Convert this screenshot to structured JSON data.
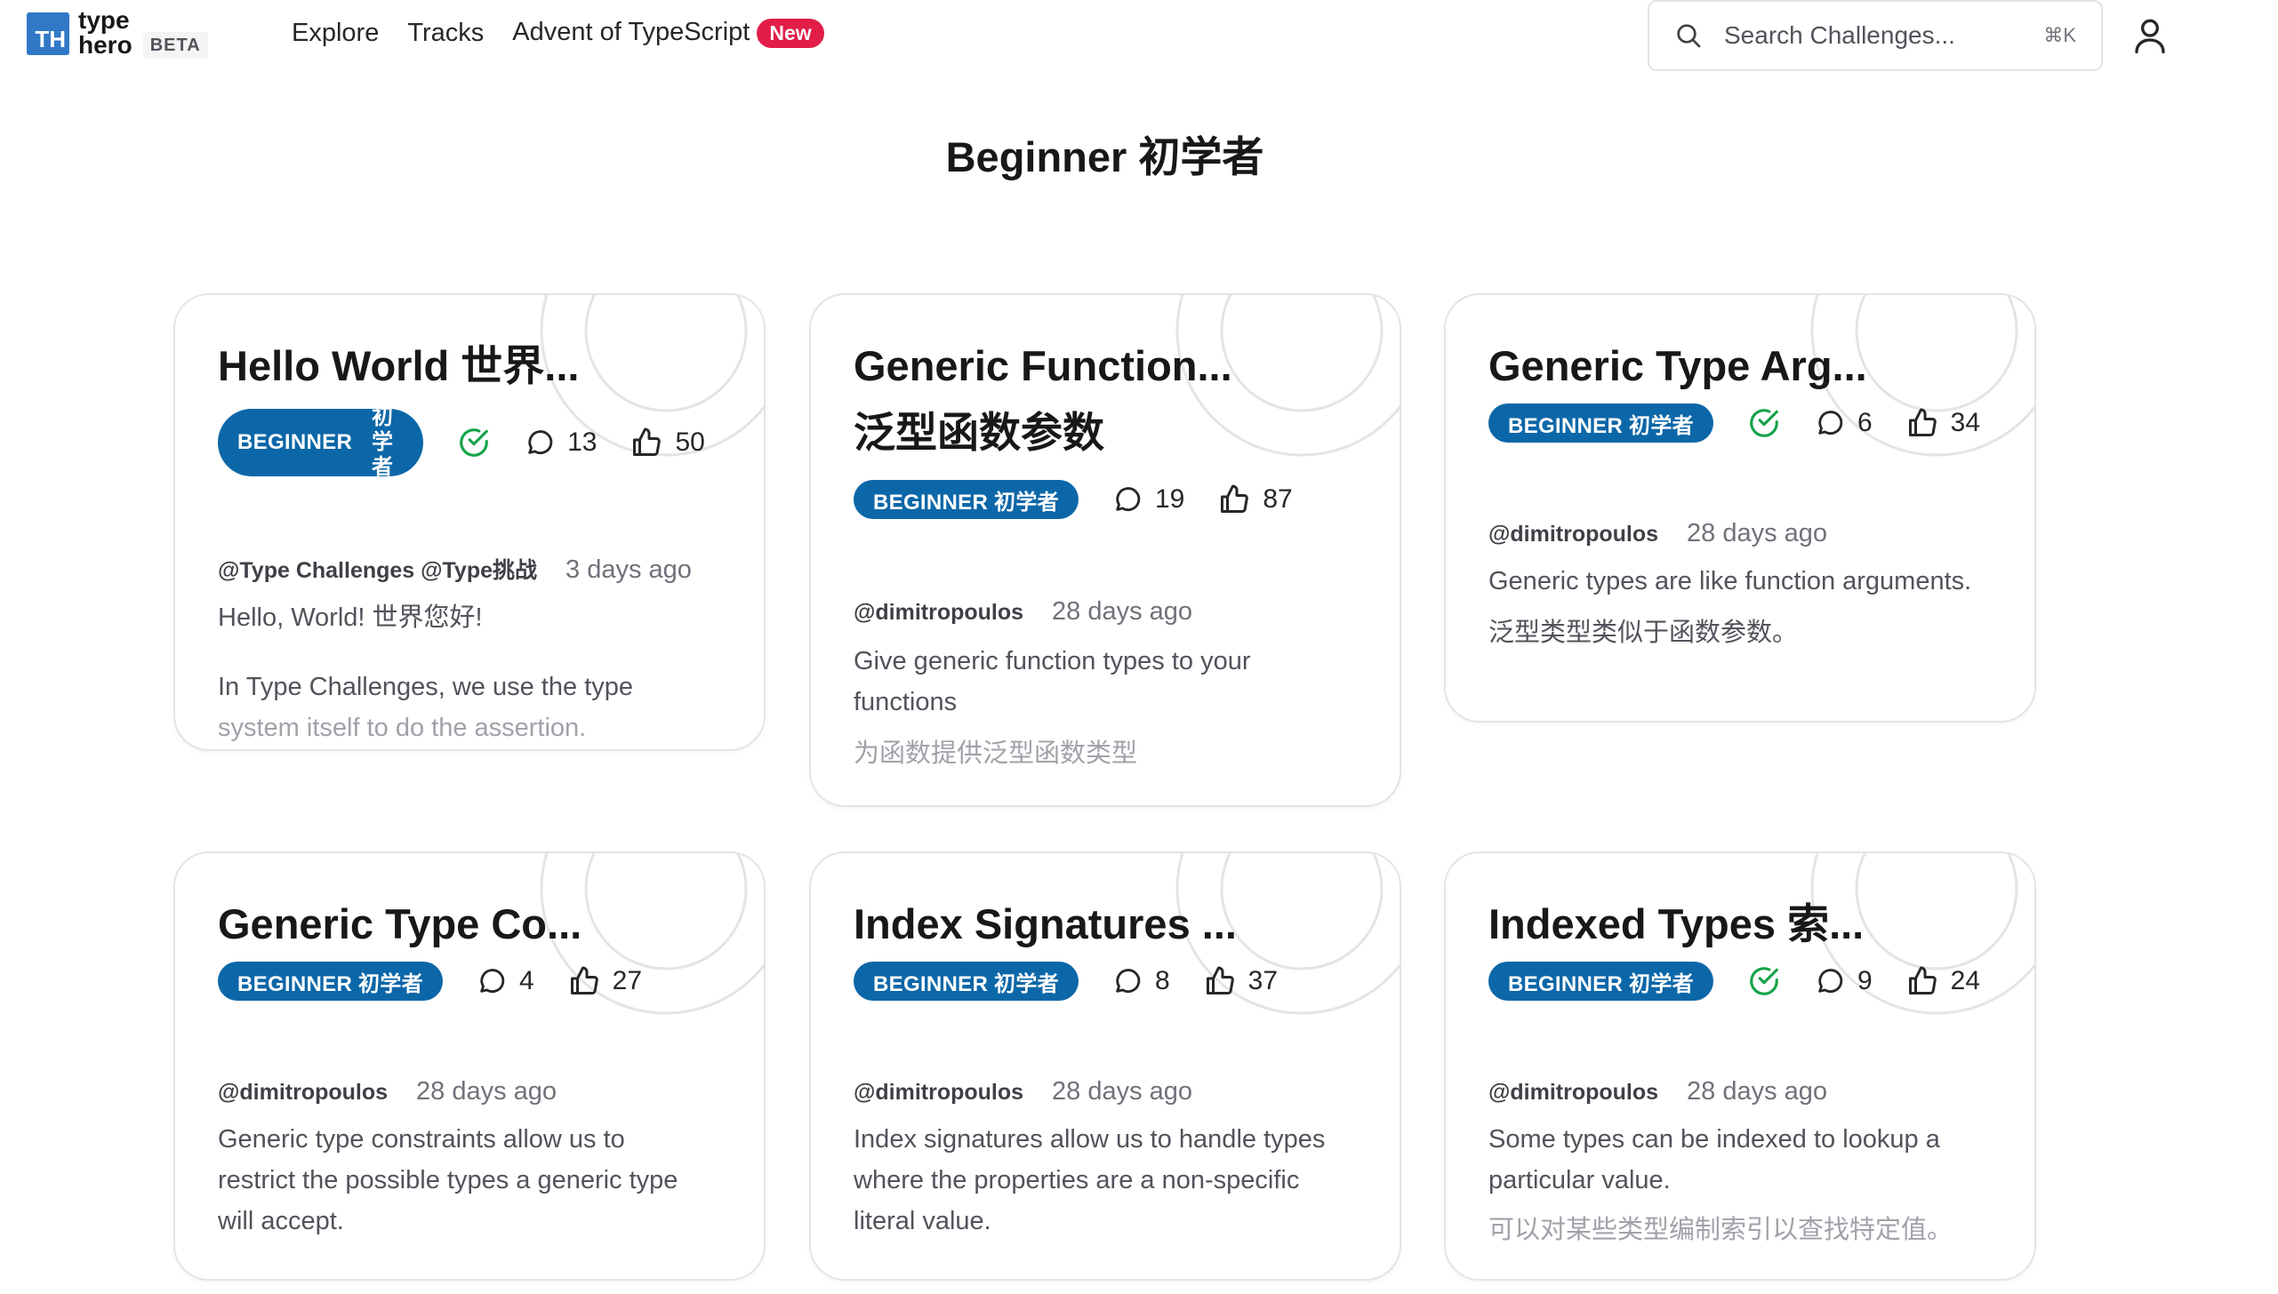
{
  "header": {
    "logo_mark": "TH",
    "logo_line1": "type",
    "logo_line2": "hero",
    "beta": "BETA",
    "nav": {
      "explore": "Explore",
      "tracks": "Tracks",
      "advent": "Advent of TypeScript",
      "new_badge": "New"
    },
    "search": {
      "placeholder": "Search Challenges...",
      "shortcut": "⌘K"
    }
  },
  "page_title": "Beginner 初学者",
  "colors": {
    "badge": "#0c67a8",
    "check": "#16a34a",
    "new": "#e11d48",
    "logo": "#3178c6"
  },
  "cards": [
    {
      "title": "Hello World 世界...",
      "badge_en": "BEGINNER",
      "badge_cn": "初学者",
      "badge_cn_line1": "初学",
      "badge_cn_line2": "者",
      "completed": true,
      "comments": "13",
      "upvotes": "50",
      "author": "@Type Challenges @Type挑战",
      "time": "3 days ago",
      "desc1": "Hello, World! 世界您好!",
      "desc2": "In Type Challenges, we use the type",
      "desc3": "system itself to do the assertion."
    },
    {
      "title_line1": "Generic Function...",
      "title_line2": "泛型函数参数",
      "badge": "BEGINNER 初学者",
      "completed": false,
      "comments": "19",
      "upvotes": "87",
      "author": "@dimitropoulos",
      "time": "28 days ago",
      "desc1": "Give generic function types to your",
      "desc2": "functions",
      "desc3": "为函数提供泛型函数类型"
    },
    {
      "title": "Generic Type Arg...",
      "badge": "BEGINNER 初学者",
      "completed": true,
      "comments": "6",
      "upvotes": "34",
      "author": "@dimitropoulos",
      "time": "28 days ago",
      "desc1": "Generic types are like function arguments.",
      "desc2": "泛型类型类似于函数参数。"
    },
    {
      "title": "Generic Type Co...",
      "badge": "BEGINNER 初学者",
      "completed": false,
      "comments": "4",
      "upvotes": "27",
      "author": "@dimitropoulos",
      "time": "28 days ago",
      "desc1": "Generic type constraints allow us to",
      "desc2": "restrict the possible types a generic type",
      "desc3": "will accept."
    },
    {
      "title": "Index Signatures ...",
      "badge": "BEGINNER 初学者",
      "completed": false,
      "comments": "8",
      "upvotes": "37",
      "author": "@dimitropoulos",
      "time": "28 days ago",
      "desc1": "Index signatures allow us to handle types",
      "desc2": "where the properties are a non-specific",
      "desc3": "literal value."
    },
    {
      "title": "Indexed Types 索...",
      "badge": "BEGINNER 初学者",
      "completed": true,
      "comments": "9",
      "upvotes": "24",
      "author": "@dimitropoulos",
      "time": "28 days ago",
      "desc1": "Some types can be indexed to lookup a",
      "desc2": "particular value.",
      "desc3": "可以对某些类型编制索引以查找特定值。"
    }
  ]
}
